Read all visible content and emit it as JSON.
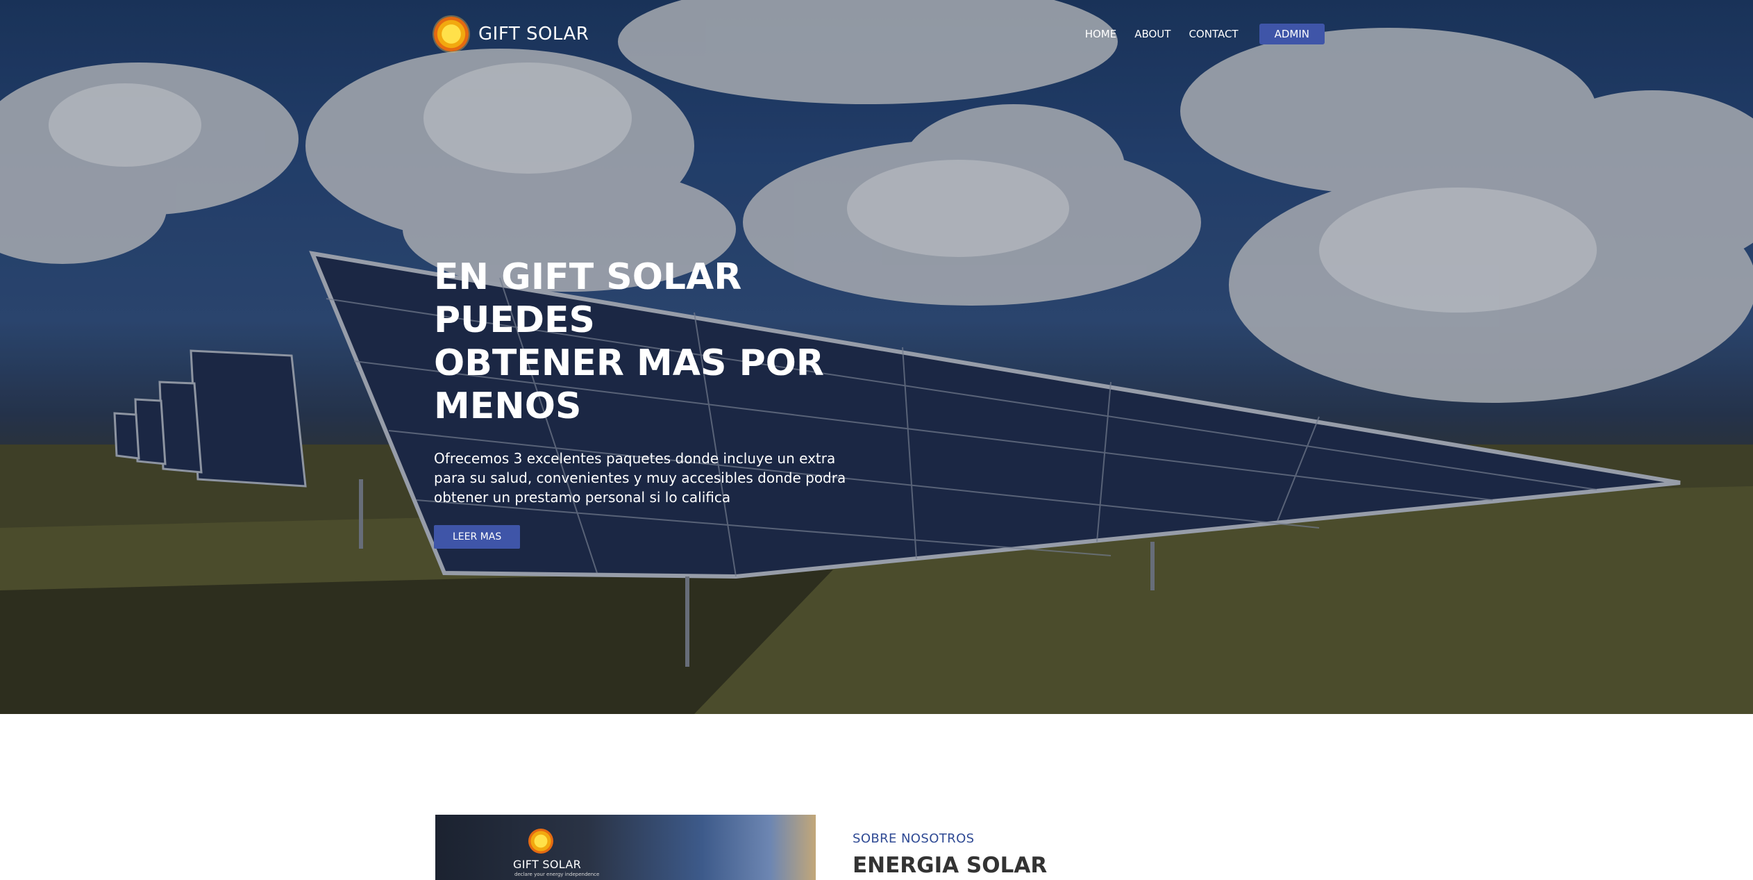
{
  "brand": {
    "name": "GIFT SOLAR"
  },
  "nav": {
    "items": [
      {
        "label": "HOME"
      },
      {
        "label": "ABOUT"
      },
      {
        "label": "CONTACT"
      }
    ],
    "admin_label": "ADMIN"
  },
  "hero": {
    "title_line1": "EN GIFT SOLAR PUEDES",
    "title_line2": "OBTENER MAS POR MENOS",
    "subtitle": "Ofrecemos 3 excelentes paquetes donde incluye un extra para su salud, convenientes y muy accesibles donde podra obtener un prestamo personal si lo califica",
    "cta_label": "LEER MAS"
  },
  "about": {
    "image_brand": "GIFT SOLAR",
    "image_tagline": "declare your energy independence",
    "kicker": "SOBRE NOSOTROS",
    "heading": "ENERGIA SOLAR"
  },
  "colors": {
    "accent": "#3f55a8",
    "kicker": "#2f4a94",
    "heading": "#333333"
  },
  "icons": {
    "logo": "sun-logo-icon"
  }
}
